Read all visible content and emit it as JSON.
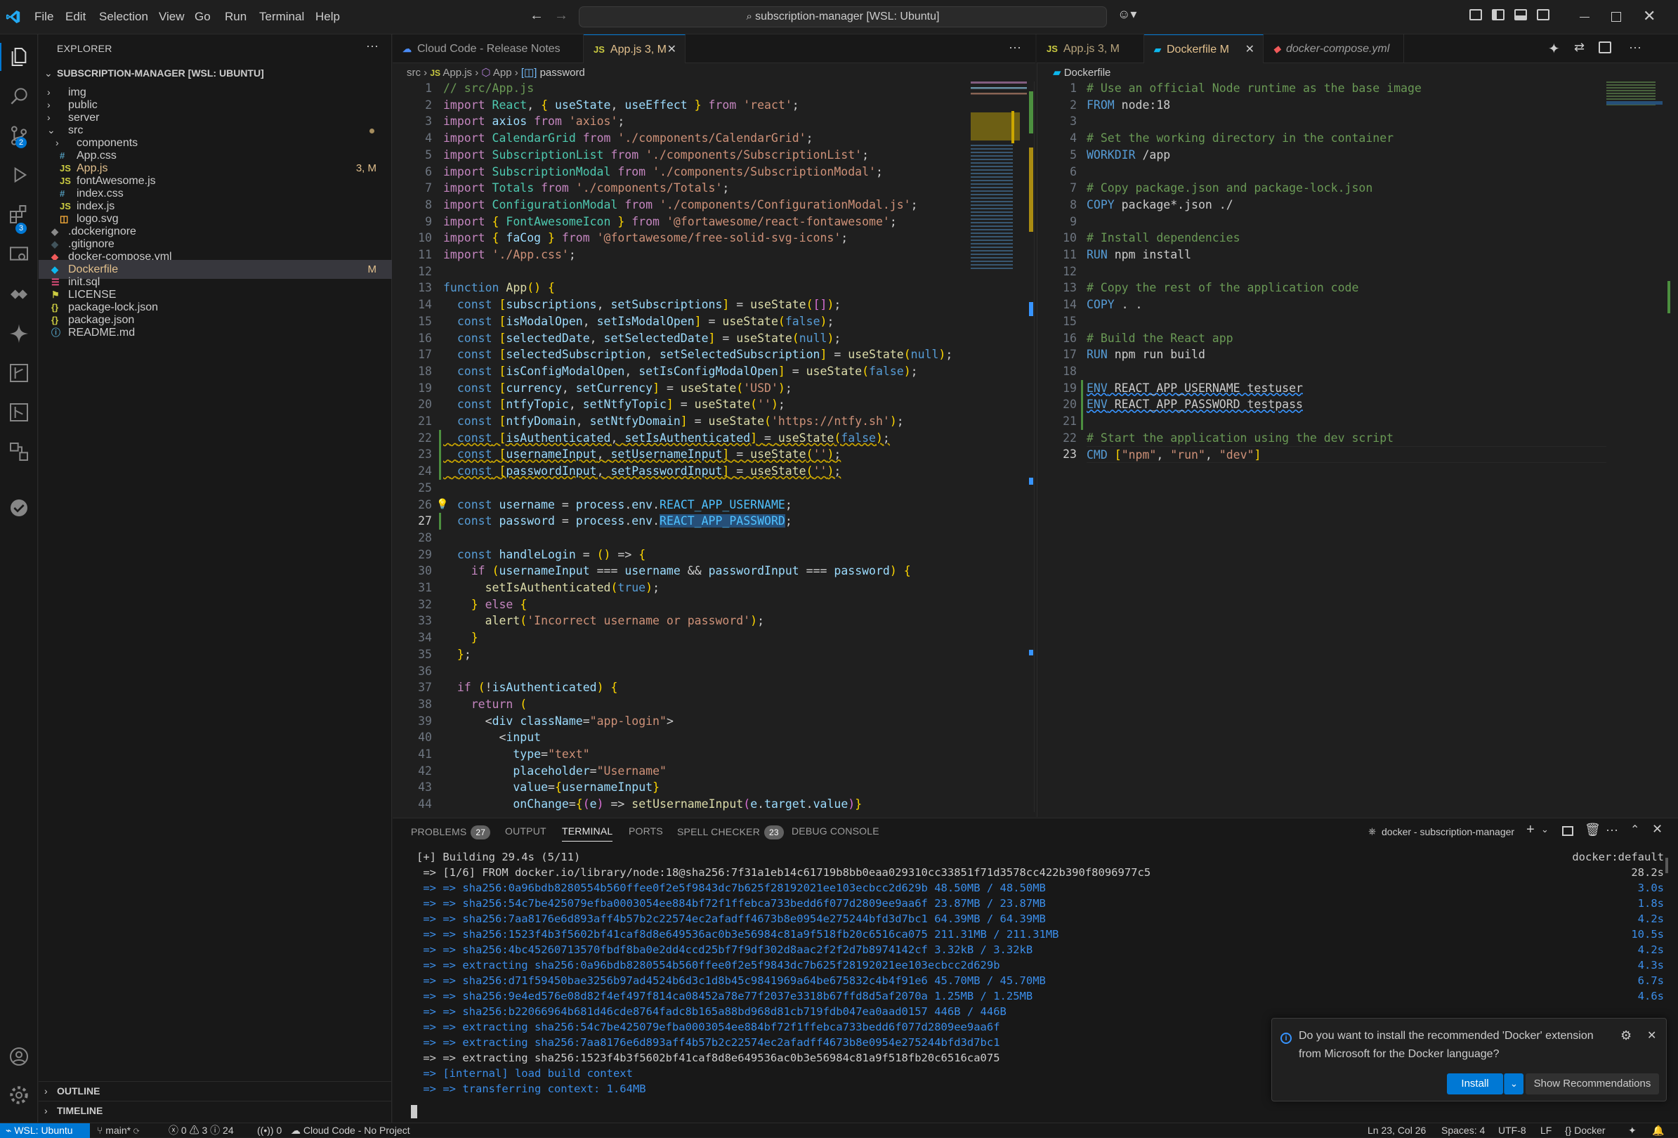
{
  "titlebar": {
    "menus": [
      "File",
      "Edit",
      "Selection",
      "View",
      "Go",
      "Run",
      "Terminal",
      "Help"
    ],
    "command_center": "subscription-manager [WSL: Ubuntu]"
  },
  "activity": {
    "scm_badge": "2",
    "ext_badge": "3"
  },
  "explorer": {
    "title": "EXPLORER",
    "root": "SUBSCRIPTION-MANAGER [WSL: UBUNTU]",
    "items": [
      {
        "label": "img",
        "kind": "folder",
        "depth": 1,
        "open": false
      },
      {
        "label": "public",
        "kind": "folder",
        "depth": 1,
        "open": false
      },
      {
        "label": "server",
        "kind": "folder",
        "depth": 1,
        "open": false
      },
      {
        "label": "src",
        "kind": "folder",
        "depth": 1,
        "open": true,
        "modified": true
      },
      {
        "label": "components",
        "kind": "folder",
        "depth": 2,
        "open": false
      },
      {
        "label": "App.css",
        "kind": "css",
        "depth": 2
      },
      {
        "label": "App.js",
        "kind": "js",
        "depth": 2,
        "badge": "3, M"
      },
      {
        "label": "fontAwesome.js",
        "kind": "js",
        "depth": 2
      },
      {
        "label": "index.css",
        "kind": "css",
        "depth": 2
      },
      {
        "label": "index.js",
        "kind": "js",
        "depth": 2
      },
      {
        "label": "logo.svg",
        "kind": "svg",
        "depth": 2
      },
      {
        "label": ".dockerignore",
        "kind": "docker-ignore",
        "depth": 1
      },
      {
        "label": ".gitignore",
        "kind": "git",
        "depth": 1
      },
      {
        "label": "docker-compose.yml",
        "kind": "compose",
        "depth": 1
      },
      {
        "label": "Dockerfile",
        "kind": "docker",
        "depth": 1,
        "badge": "M",
        "selected": true
      },
      {
        "label": "init.sql",
        "kind": "sql",
        "depth": 1
      },
      {
        "label": "LICENSE",
        "kind": "license",
        "depth": 1
      },
      {
        "label": "package-lock.json",
        "kind": "json",
        "depth": 1
      },
      {
        "label": "package.json",
        "kind": "json",
        "depth": 1
      },
      {
        "label": "README.md",
        "kind": "info",
        "depth": 1
      }
    ],
    "outline": "OUTLINE",
    "timeline": "TIMELINE"
  },
  "left_editor": {
    "tabs": [
      {
        "label": "Cloud Code - Release Notes",
        "icon": "cloud-icon",
        "active": false
      },
      {
        "label": "App.js 3, M",
        "icon": "JS",
        "active": true
      }
    ],
    "breadcrumb": [
      "src",
      "App.js",
      "App",
      "password"
    ],
    "lines": [
      "// src/App.js",
      "import React, { useState, useEffect } from 'react';",
      "import axios from 'axios';",
      "import CalendarGrid from './components/CalendarGrid';",
      "import SubscriptionList from './components/SubscriptionList';",
      "import SubscriptionModal from './components/SubscriptionModal';",
      "import Totals from './components/Totals';",
      "import ConfigurationModal from './components/ConfigurationModal.js';",
      "import { FontAwesomeIcon } from '@fortawesome/react-fontawesome';",
      "import { faCog } from '@fortawesome/free-solid-svg-icons';",
      "import './App.css';",
      "",
      "function App() {",
      "  const [subscriptions, setSubscriptions] = useState([]);",
      "  const [isModalOpen, setIsModalOpen] = useState(false);",
      "  const [selectedDate, setSelectedDate] = useState(null);",
      "  const [selectedSubscription, setSelectedSubscription] = useState(null);",
      "  const [isConfigModalOpen, setIsConfigModalOpen] = useState(false);",
      "  const [currency, setCurrency] = useState('USD');",
      "  const [ntfyTopic, setNtfyTopic] = useState('');",
      "  const [ntfyDomain, setNtfyDomain] = useState('https://ntfy.sh');",
      "  const [isAuthenticated, setIsAuthenticated] = useState(false);",
      "  const [usernameInput, setUsernameInput] = useState('');",
      "  const [passwordInput, setPasswordInput] = useState('');",
      "",
      "  const username = process.env.REACT_APP_USERNAME;",
      "  const password = process.env.REACT_APP_PASSWORD;",
      "",
      "  const handleLogin = () => {",
      "    if (usernameInput === username && passwordInput === password) {",
      "      setIsAuthenticated(true);",
      "    } else {",
      "      alert('Incorrect username or password');",
      "    }",
      "  };",
      "",
      "  if (!isAuthenticated) {",
      "    return (",
      "      <div className=\"app-login\">",
      "        <input",
      "          type=\"text\"",
      "          placeholder=\"Username\"",
      "          value={usernameInput}",
      "          onChange={(e) => setUsernameInput(e.target.value)}"
    ]
  },
  "right_editor": {
    "tabs": [
      {
        "label": "App.js 3, M",
        "icon": "JS",
        "active": false
      },
      {
        "label": "Dockerfile M",
        "icon": "docker-icon",
        "active": true
      },
      {
        "label": "docker-compose.yml",
        "icon": "compose-icon",
        "active": false
      }
    ],
    "breadcrumb": [
      "Dockerfile"
    ],
    "lines": [
      "# Use an official Node runtime as the base image",
      "FROM node:18",
      "",
      "# Set the working directory in the container",
      "WORKDIR /app",
      "",
      "# Copy package.json and package-lock.json",
      "COPY package*.json ./",
      "",
      "# Install dependencies",
      "RUN npm install",
      "",
      "# Copy the rest of the application code",
      "COPY . .",
      "",
      "# Build the React app",
      "RUN npm run build",
      "",
      "ENV REACT_APP_USERNAME testuser",
      "ENV REACT_APP_PASSWORD testpass",
      "",
      "# Start the application using the dev script",
      "CMD [\"npm\", \"run\", \"dev\"]"
    ]
  },
  "panel": {
    "tabs": [
      {
        "label": "PROBLEMS",
        "badge": "27"
      },
      {
        "label": "OUTPUT"
      },
      {
        "label": "TERMINAL",
        "active": true
      },
      {
        "label": "PORTS"
      },
      {
        "label": "SPELL CHECKER",
        "badge": "23"
      },
      {
        "label": "DEBUG CONSOLE"
      }
    ],
    "terminal_name": "docker - subscription-manager",
    "terminal": [
      {
        "text": "[+] Building 29.4s (5/11)",
        "right": "docker:default",
        "color": "#cccccc"
      },
      {
        "text": " => [1/6] FROM docker.io/library/node:18@sha256:7f31a1eb14c61719b8bb0eaa029310cc33851f71d3578cc422b390f8096977c5",
        "right": "28.2s",
        "color": "#cccccc"
      },
      {
        "text": " => => sha256:0a96bdb8280554b560ffee0f2e5f9843dc7b625f28192021ee103ecbcc2d629b 48.50MB / 48.50MB",
        "right": "3.0s",
        "color": "#3b8eea"
      },
      {
        "text": " => => sha256:54c7be425079efba0003054ee884bf72f1ffebca733bedd6f077d2809ee9aa6f 23.87MB / 23.87MB",
        "right": "1.8s",
        "color": "#3b8eea"
      },
      {
        "text": " => => sha256:7aa8176e6d893aff4b57b2c22574ec2afadff4673b8e0954e275244bfd3d7bc1 64.39MB / 64.39MB",
        "right": "4.2s",
        "color": "#3b8eea"
      },
      {
        "text": " => => sha256:1523f4b3f5602bf41caf8d8e649536ac0b3e56984c81a9f518fb20c6516ca075 211.31MB / 211.31MB",
        "right": "10.5s",
        "color": "#3b8eea"
      },
      {
        "text": " => => sha256:4bc45260713570fbdf8ba0e2dd4ccd25bf7f9df302d8aac2f2f2d7b8974142cf 3.32kB / 3.32kB",
        "right": "4.2s",
        "color": "#3b8eea"
      },
      {
        "text": " => => extracting sha256:0a96bdb8280554b560ffee0f2e5f9843dc7b625f28192021ee103ecbcc2d629b",
        "right": "4.3s",
        "color": "#3b8eea"
      },
      {
        "text": " => => sha256:d71f59450bae3256b97ad4524b6d3c1d8b45c9841969a64be675832c4b4f91e6 45.70MB / 45.70MB",
        "right": "6.7s",
        "color": "#3b8eea"
      },
      {
        "text": " => => sha256:9e4ed576e08d82f4ef497f814ca08452a78e77f2037e3318b67ffd8d5af2070a 1.25MB / 1.25MB",
        "right": "4.6s",
        "color": "#3b8eea"
      },
      {
        "text": " => => sha256:b22066964b681d46cde8764fadc8b165a88bd968d81cb719fdb047ea0aad0157 446B / 446B",
        "right": "",
        "color": "#3b8eea"
      },
      {
        "text": " => => extracting sha256:54c7be425079efba0003054ee884bf72f1ffebca733bedd6f077d2809ee9aa6f",
        "right": "",
        "color": "#3b8eea"
      },
      {
        "text": " => => extracting sha256:7aa8176e6d893aff4b57b2c22574ec2afadff4673b8e0954e275244bfd3d7bc1",
        "right": "",
        "color": "#3b8eea"
      },
      {
        "text": " => => extracting sha256:1523f4b3f5602bf41caf8d8e649536ac0b3e56984c81a9f518fb20c6516ca075",
        "right": "",
        "color": "#cccccc"
      },
      {
        "text": " => [internal] load build context",
        "right": "",
        "color": "#3b8eea"
      },
      {
        "text": " => => transferring context: 1.64MB",
        "right": "",
        "color": "#3b8eea"
      }
    ]
  },
  "notification": {
    "message_line1": "Do you want to install the recommended 'Docker' extension",
    "message_line2": "from Microsoft for the Docker language?",
    "install": "Install",
    "recommend": "Show Recommendations"
  },
  "statusbar": {
    "remote": "WSL: Ubuntu",
    "branch": "main*",
    "problems": "0",
    "warnings": "3",
    "infos": "24",
    "ports": "0",
    "cloud": "Cloud Code - No Project",
    "position": "Ln 23, Col 26",
    "spaces": "Spaces: 4",
    "encoding": "UTF-8",
    "eol": "LF",
    "language": "Docker"
  },
  "colors": {
    "accent": "#0078d4",
    "modified": "#e2c08d",
    "js": "#cbcb41",
    "docker": "#0db7ed"
  }
}
